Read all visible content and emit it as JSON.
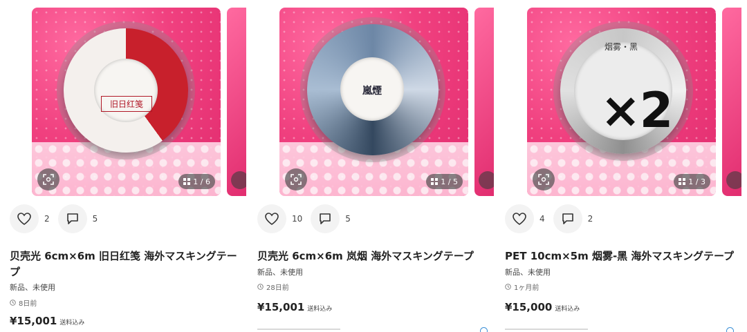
{
  "listings": [
    {
      "likes": "2",
      "comments": "5",
      "title": "贝壳光 6cm×6m 旧日红笺 海外マスキングテープ",
      "condition": "新品、未使用",
      "posted": "8日前",
      "price": "¥15,001",
      "shipping": "送料込み",
      "page": "1 / 6",
      "tape_label": "旧日红笺",
      "icons": [
        "scan-icon",
        "grid-icon",
        "heart-icon",
        "comment-icon",
        "clock-icon"
      ]
    },
    {
      "likes": "10",
      "comments": "5",
      "title": "贝壳光 6cm×6m 岚烟 海外マスキングテープ",
      "condition": "新品、未使用",
      "posted": "28日前",
      "price": "¥15,001",
      "shipping": "送料込み",
      "page": "1 / 5",
      "tape_label": "嵐煙"
    },
    {
      "likes": "4",
      "comments": "2",
      "title": "PET 10cm×5m 烟雾-黑 海外マスキングテープ",
      "condition": "新品、未使用",
      "posted": "1ヶ月前",
      "price": "¥15,000",
      "shipping": "送料込み",
      "page": "1 / 3",
      "tape_label": "烟雾・黑",
      "overlay": "×2"
    }
  ],
  "colors": {
    "photo_bg": "#f0407f",
    "badge_bg": "#464646",
    "accent_blue": "#3a8fd6"
  }
}
